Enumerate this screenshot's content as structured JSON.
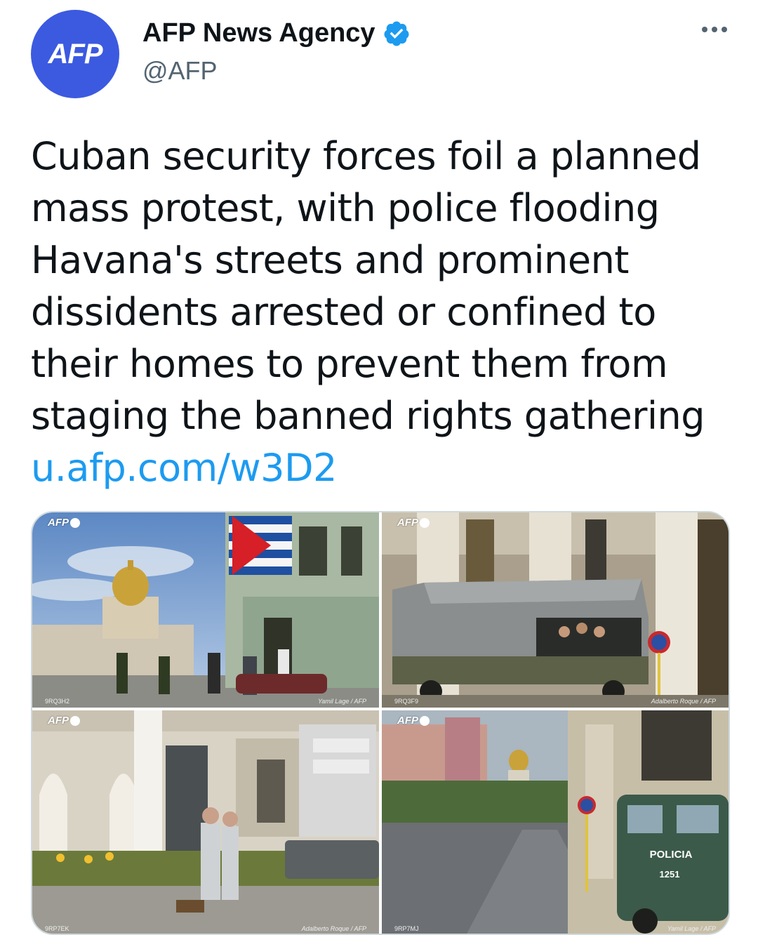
{
  "author": {
    "avatar_text": "AFP",
    "display_name": "AFP News Agency",
    "handle": "@AFP",
    "verified_icon": "verified-badge-icon",
    "avatar_color": "#3c5ae0",
    "verified_color": "#1d9bf0"
  },
  "menu": {
    "icon": "more-horizontal-icon"
  },
  "tweet": {
    "text": "Cuban security forces foil a planned mass protest, with police flooding Havana's streets and prominent dissidents arrested or confined to their homes to prevent them from staging the banned rights gathering",
    "link": "u.afp.com/w3D2",
    "link_color": "#1d9bf0"
  },
  "photos": [
    {
      "watermark": "AFP",
      "code": "9RQ3H2",
      "credit": "Yamil Lage / AFP"
    },
    {
      "watermark": "AFP",
      "code": "9RQ3F9",
      "credit": "Adalberto Roque / AFP"
    },
    {
      "watermark": "AFP",
      "code": "9RP7EK",
      "credit": "Adalberto Roque / AFP"
    },
    {
      "watermark": "AFP",
      "code": "9RP7MJ",
      "credit": "Yamil Lage / AFP",
      "vehicle_text": "POLICIA",
      "vehicle_number": "1251"
    }
  ]
}
